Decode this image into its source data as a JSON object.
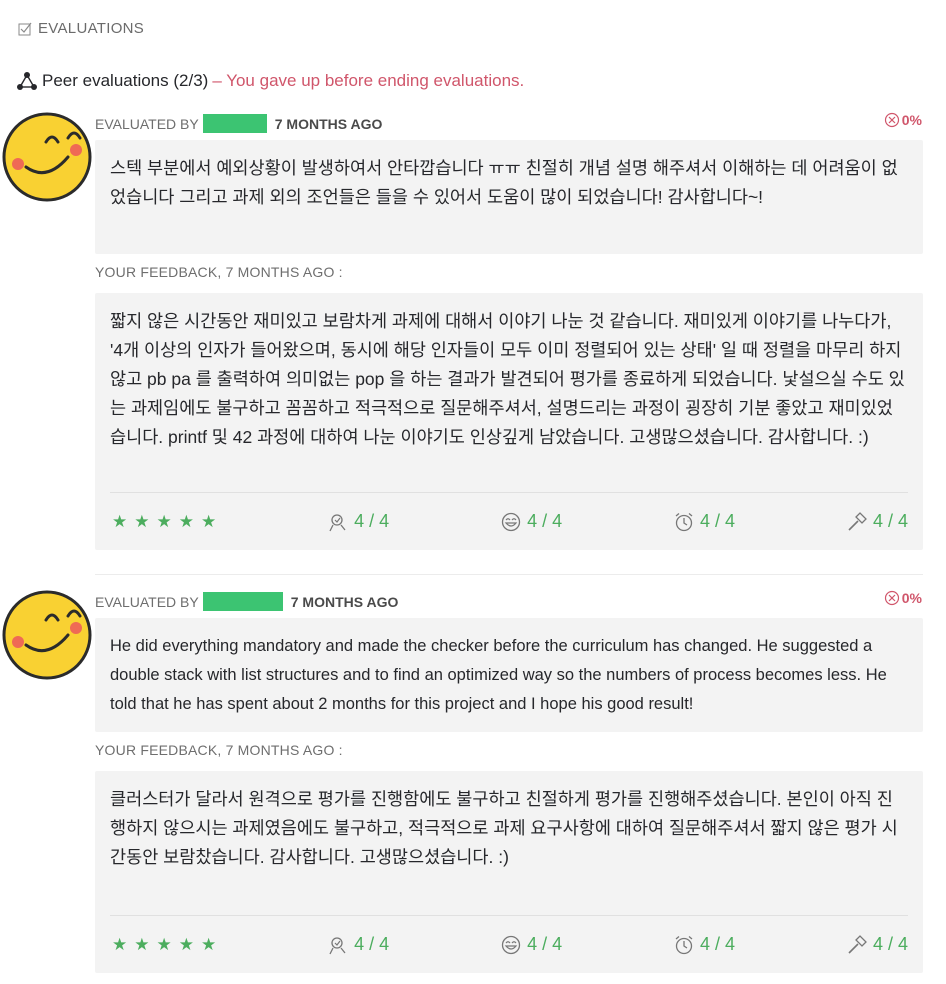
{
  "section": {
    "title": "EVALUATIONS",
    "icon": "checkbox-icon"
  },
  "peer": {
    "title": "Peer evaluations (2/3)",
    "warning": "– You gave up before ending evaluations."
  },
  "colors": {
    "accent_green": "#4cad5e",
    "warning_red": "#d0566b",
    "mask_green": "#3cc472"
  },
  "evaluations": [
    {
      "evaluated_by": "EVALUATED BY",
      "time_ago": "7 MONTHS AGO",
      "score": "0%",
      "comment": "스텍 부분에서 예외상황이 발생하여서 안타깝습니다 ㅠㅠ 친절히 개념 설명 해주셔서 이해하는 데 어려움이 없었습니다 그리고 과제 외의 조언들은 들을 수 있어서 도움이 많이 되었습니다! 감사합니다~!",
      "feedback_label": "YOUR FEEDBACK, 7 MONTHS AGO :",
      "feedback": "짧지 않은 시간동안 재미있고 보람차게 과제에 대해서 이야기 나눈 것 같습니다. 재미있게 이야기를 나누다가, '4개 이상의 인자가 들어왔으며, 동시에 해당 인자들이 모두 이미 정렬되어 있는 상태' 일 때 정렬을 마무리 하지 않고 pb pa 를 출력하여 의미없는 pop 을 하는 결과가 발견되어 평가를 종료하게 되었습니다. 낯설으실 수도 있는 과제임에도 불구하고 꼼꼼하고 적극적으로 질문해주셔서, 설명드리는 과정이 굉장히 기분 좋았고 재미있었습니다. printf 및 42 과정에 대하여 나눈 이야기도 인상깊게 남았습니다. 고생많으셨습니다. 감사합니다. :)",
      "stars": [
        "★",
        "★",
        "★",
        "★",
        "★"
      ],
      "criteria": [
        {
          "icon": "interest-icon",
          "value": "4 / 4"
        },
        {
          "icon": "nice-smiley-icon",
          "value": "4 / 4"
        },
        {
          "icon": "punctuality-clock-icon",
          "value": "4 / 4"
        },
        {
          "icon": "rigor-hammer-icon",
          "value": "4 / 4"
        }
      ]
    },
    {
      "evaluated_by": "EVALUATED BY",
      "time_ago": "7 MONTHS AGO",
      "score": "0%",
      "comment": "He did everything mandatory and made the checker before the curriculum has changed. He suggested a double stack with list structures and to find an optimized way so the numbers of process becomes less. He told that he has spent about 2 months for this project and I hope his good result!",
      "feedback_label": "YOUR FEEDBACK, 7 MONTHS AGO :",
      "feedback": "클러스터가 달라서 원격으로 평가를 진행함에도 불구하고 친절하게 평가를 진행해주셨습니다. 본인이 아직 진행하지 않으시는 과제였음에도 불구하고, 적극적으로 과제 요구사항에 대하여 질문해주셔서 짧지 않은 평가 시간동안 보람찼습니다. 감사합니다. 고생많으셨습니다. :)",
      "stars": [
        "★",
        "★",
        "★",
        "★",
        "★"
      ],
      "criteria": [
        {
          "icon": "interest-icon",
          "value": "4 / 4"
        },
        {
          "icon": "nice-smiley-icon",
          "value": "4 / 4"
        },
        {
          "icon": "punctuality-clock-icon",
          "value": "4 / 4"
        },
        {
          "icon": "rigor-hammer-icon",
          "value": "4 / 4"
        }
      ]
    }
  ]
}
